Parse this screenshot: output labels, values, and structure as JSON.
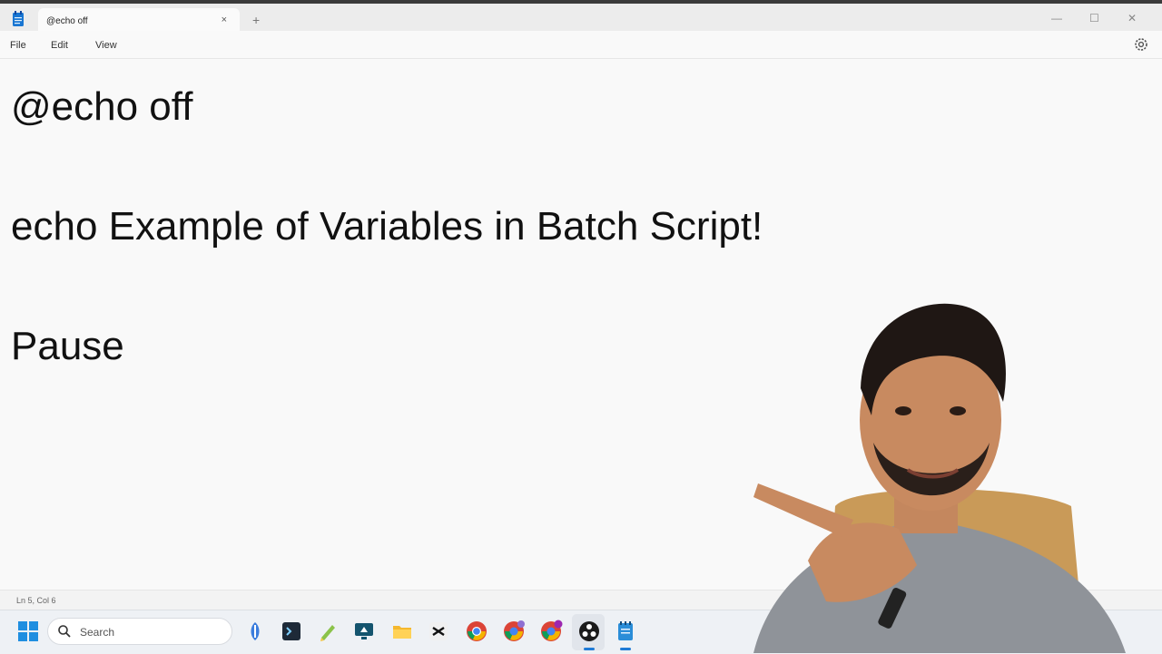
{
  "window": {
    "tab_title": "@echo off",
    "tab_close": "×",
    "new_tab": "+",
    "minimize": "—",
    "maximize": "☐",
    "close": "✕"
  },
  "menu": {
    "file": "File",
    "edit": "Edit",
    "view": "View"
  },
  "editor": {
    "lines": [
      "@echo off",
      "echo Example of Variables in Batch Script!",
      "Pause"
    ]
  },
  "status": {
    "position": "Ln 5, Col 6"
  },
  "taskbar": {
    "search_placeholder": "Search",
    "apps": [
      "copilot-icon",
      "terminal-icon",
      "notepad-pencil-icon",
      "remote-desktop-icon",
      "file-explorer-icon",
      "capcut-icon",
      "chrome-icon",
      "chrome-profile-icon",
      "chrome-profile-2-icon",
      "obs-icon",
      "notepad-icon"
    ]
  },
  "colors": {
    "accent": "#1f7bd6",
    "editor_bg": "#f9f9f9",
    "taskbar_bg": "#eef1f5"
  }
}
